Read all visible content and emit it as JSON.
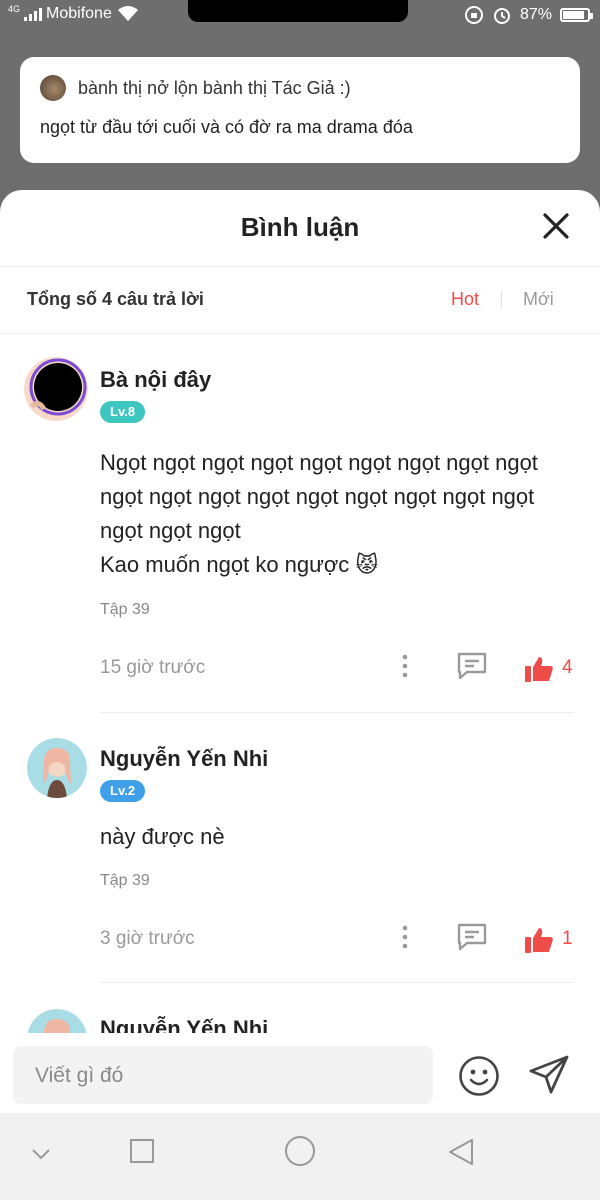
{
  "status_bar": {
    "network": "4G",
    "carrier": "Mobifone",
    "battery": "87%",
    "battery_level": 0.87
  },
  "preview_comment": {
    "author": "bành thị nở lộn bành thị Tác Giả :)",
    "text": "ngọt từ đầu tới cuối và có đờ ra ma drama đóa"
  },
  "sheet": {
    "title": "Bình luận",
    "total_label": "Tổng số 4 câu trả lời",
    "sort_hot": "Hot",
    "sort_new": "Mới"
  },
  "comments": [
    {
      "name": "Bà nội đây",
      "level": "Lv.8",
      "level_color": "#3ec6c0",
      "text": "Ngọt ngọt ngọt ngọt ngọt ngọt ngọt ngọt ngọt\nngọt ngọt ngọt ngọt ngọt ngọt ngọt ngọt ngọt\nngọt ngọt ngọt\nKao muốn ngọt ko ngược 😾",
      "episode": "Tập 39",
      "time": "15 giờ trước",
      "likes": "4"
    },
    {
      "name": "Nguyễn Yến Nhi",
      "level": "Lv.2",
      "level_color": "#3f9fe8",
      "text": "này được nè",
      "episode": "Tập 39",
      "time": "3 giờ trước",
      "likes": "1"
    },
    {
      "name": "Nguyễn Yến Nhi"
    }
  ],
  "input": {
    "placeholder": "Viết gì đó"
  },
  "colors": {
    "accent": "#ef4b48",
    "overlay": "#6e6e6e"
  }
}
